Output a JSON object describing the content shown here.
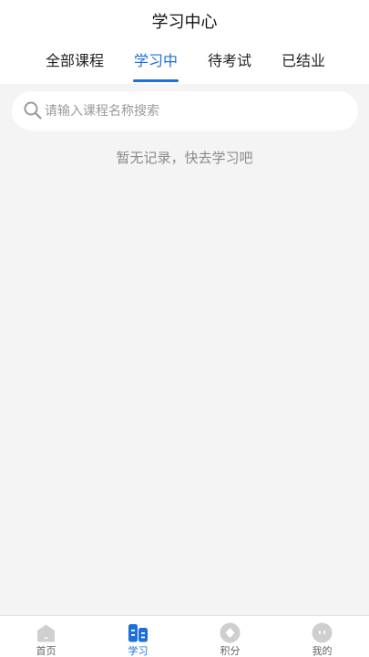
{
  "header": {
    "title": "学习中心"
  },
  "tabs": [
    {
      "label": "全部课程",
      "active": false
    },
    {
      "label": "学习中",
      "active": true
    },
    {
      "label": "待考试",
      "active": false
    },
    {
      "label": "已结业",
      "active": false
    }
  ],
  "search": {
    "placeholder": "请输入课程名称搜索",
    "value": ""
  },
  "empty_state": {
    "message": "暂无记录，快去学习吧"
  },
  "bottom_nav": [
    {
      "label": "首页",
      "icon": "home-icon",
      "active": false
    },
    {
      "label": "学习",
      "icon": "study-icon",
      "active": true
    },
    {
      "label": "积分",
      "icon": "points-icon",
      "active": false
    },
    {
      "label": "我的",
      "icon": "profile-icon",
      "active": false
    }
  ],
  "colors": {
    "accent": "#1e6fd9",
    "inactive_icon": "#cfcfcf",
    "background": "#f4f4f4"
  }
}
